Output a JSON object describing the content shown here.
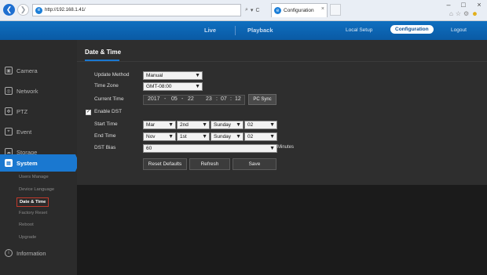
{
  "browser": {
    "url": "http://192.168.1.41/",
    "tab_title": "Configuration",
    "tab_close": "×",
    "back_glyph": "❮",
    "forward_glyph": "❯",
    "search_glyph": "⌕",
    "dropdown_glyph": "▾",
    "refresh_glyph": "C",
    "win_min": "–",
    "win_max": "□",
    "win_close": "×",
    "home_glyph": "⌂",
    "star_glyph": "☆",
    "gear_glyph": "⚙",
    "smile_glyph": "☻"
  },
  "topbar": {
    "live": "Live",
    "playback": "Playback",
    "local_setup": "Local Setup",
    "configuration": "Configuration",
    "logout": "Logout"
  },
  "sidebar": {
    "camera": "Camera",
    "network": "Network",
    "ptz": "PTZ",
    "event": "Event",
    "storage": "Storage",
    "system": "System",
    "information": "Information",
    "sub": {
      "users_manage": "Users Manage",
      "device_language": "Device Language",
      "date_time": "Date & Time",
      "factory_reset": "Factory Reset",
      "reboot": "Reboot",
      "upgrade": "Upgrade"
    }
  },
  "page": {
    "title": "Date & Time",
    "update_method": {
      "label": "Update Method",
      "value": "Manual"
    },
    "time_zone": {
      "label": "Time Zone",
      "value": "GMT-08:00"
    },
    "current_time": {
      "label": "Current Time",
      "year": "2017",
      "month": "05",
      "day": "22",
      "hour": "23",
      "minute": "07",
      "second": "12",
      "date_sep": "-",
      "time_sep": ":"
    },
    "pc_sync": "PC Sync",
    "enable_dst": {
      "label": "Enable DST",
      "checked": "✓"
    },
    "start_time": {
      "label": "Start Time",
      "month": "Mar",
      "week": "2nd",
      "day": "Sunday",
      "hour": "02"
    },
    "end_time": {
      "label": "End Time",
      "month": "Nov",
      "week": "1st",
      "day": "Sunday",
      "hour": "02"
    },
    "dst_bias": {
      "label": "DST Bias",
      "value": "60",
      "unit": "Minutes"
    },
    "buttons": {
      "reset": "Reset Defaults",
      "refresh": "Refresh",
      "save": "Save"
    },
    "arrow": "▼"
  },
  "colors": {
    "accent": "#1a78d0",
    "topbar": "#0a5aa4",
    "panel": "#2e2e2e",
    "sidebar": "#2b2b2b",
    "highlight_border": "#c0392b"
  }
}
